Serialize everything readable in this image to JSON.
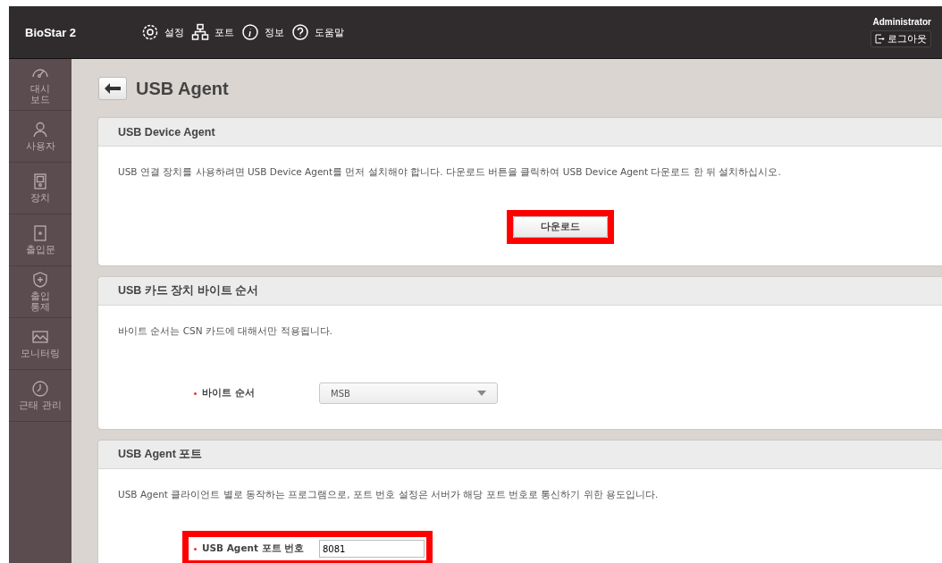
{
  "header": {
    "logo": "BioStar 2",
    "nav": [
      {
        "kind": "gear",
        "label": "설정"
      },
      {
        "kind": "network",
        "label": "포트"
      },
      {
        "kind": "info",
        "label": "정보"
      },
      {
        "kind": "help",
        "label": "도움말"
      }
    ],
    "user": "Administrator",
    "logout": "로그아웃"
  },
  "sidebar": {
    "items": [
      {
        "kind": "gauge",
        "label": "대시\n보드"
      },
      {
        "kind": "user",
        "label": "사용자"
      },
      {
        "kind": "device",
        "label": "장치"
      },
      {
        "kind": "door",
        "label": "출입문"
      },
      {
        "kind": "shield",
        "label": "출입\n통제"
      },
      {
        "kind": "monitor",
        "label": "모니터링"
      },
      {
        "kind": "clock",
        "label": "근태 관리"
      }
    ]
  },
  "page": {
    "title": "USB Agent"
  },
  "sections": [
    {
      "kind": "button",
      "title": "USB Device Agent",
      "description": "USB 연결 장치를 사용하려면 USB Device Agent를 먼저 설치해야 합니다. 다운로드 버튼을 클릭하여 USB Device Agent 다운로드 한 뒤 설치하십시오.",
      "button": "다운로드",
      "highlighted": true
    },
    {
      "kind": "select",
      "title": "USB 카드 장치 바이트 순서",
      "description": "바이트 순서는 CSN 카드에 대해서만 적용됩니다.",
      "label": "바이트 순서",
      "value": "MSB",
      "highlighted": false
    },
    {
      "kind": "input",
      "title": "USB Agent 포트",
      "description": "USB Agent 클라이언트 별로 동작하는 프로그램으로, 포트 번호 설정은 서버가 해당 포트 번호로 통신하기 위한 용도입니다.",
      "label": "USB Agent 포트 번호",
      "value": "8081",
      "highlighted": true
    }
  ]
}
